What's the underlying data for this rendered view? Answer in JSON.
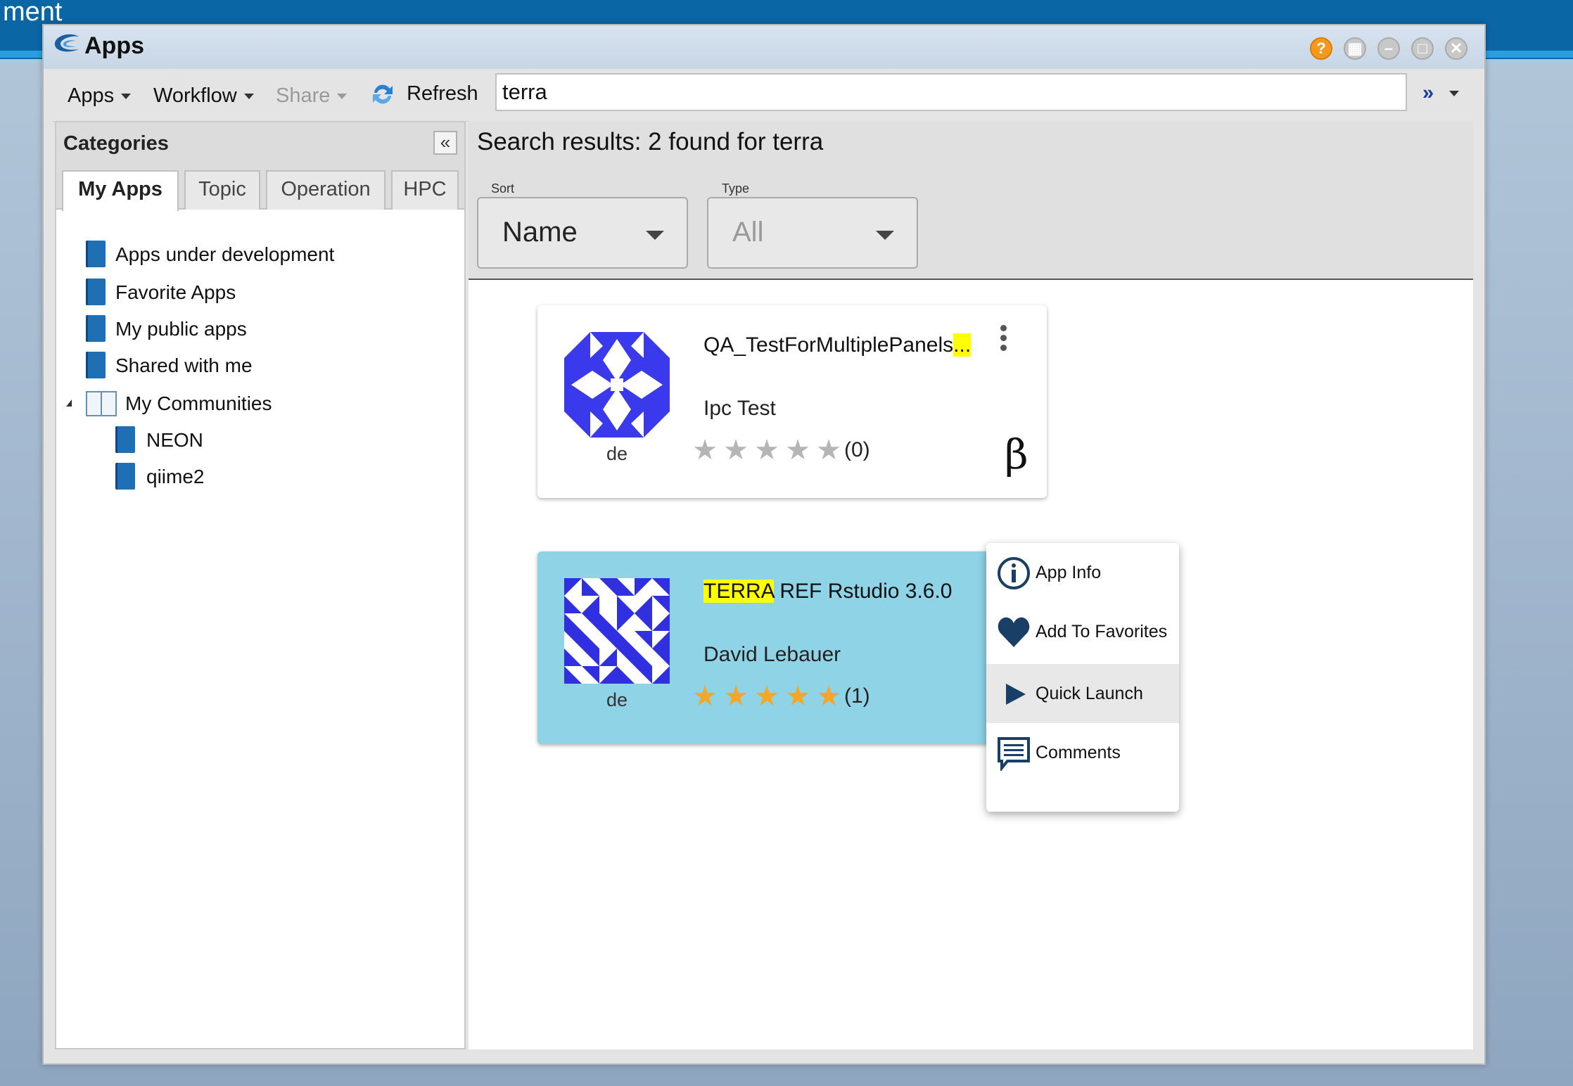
{
  "background": {
    "partial_title": "ment"
  },
  "window": {
    "title": "Apps",
    "buttons": [
      "help-icon",
      "layout-icon",
      "minimize-icon",
      "maximize-icon",
      "close-icon"
    ],
    "help_color": "#f39a1e"
  },
  "toolbar": {
    "apps": "Apps",
    "workflow": "Workflow",
    "share": "Share",
    "refresh": "Refresh",
    "search_value": "terra"
  },
  "categories": {
    "title": "Categories",
    "tabs": [
      "My Apps",
      "Topic",
      "Operation",
      "HPC"
    ],
    "active_tab": "My Apps",
    "items": [
      {
        "label": "Apps under development"
      },
      {
        "label": "Favorite Apps"
      },
      {
        "label": "My public apps"
      },
      {
        "label": "Shared with me"
      },
      {
        "label": "My Communities"
      },
      {
        "label": "NEON"
      },
      {
        "label": "qiime2"
      }
    ]
  },
  "results": {
    "title": "Search results: 2 found for terra",
    "sort_label": "Sort",
    "sort_value": "Name",
    "type_label": "Type",
    "type_value": "All",
    "cards": [
      {
        "name_prefix": "QA_TestForMultiplePanels",
        "name_highlight": "...",
        "name_suffix": "",
        "subtitle": "Ipc Test",
        "owner": "de",
        "rating": "(0)",
        "stars_filled": 0,
        "beta": "β"
      },
      {
        "name_prefix": "",
        "name_highlight": "TERRA",
        "name_suffix": " REF Rstudio 3.6.0",
        "subtitle": "David Lebauer",
        "owner": "de",
        "rating": "(1)",
        "stars_filled": 5
      }
    ]
  },
  "context_menu": {
    "items": [
      {
        "label": "App Info",
        "icon": "info-icon"
      },
      {
        "label": "Add To Favorites",
        "icon": "heart-icon"
      },
      {
        "label": "Quick Launch",
        "icon": "play-icon"
      },
      {
        "label": "Comments",
        "icon": "comment-icon"
      }
    ],
    "hovered": "Quick Launch"
  },
  "colors": {
    "accent_dark": "#1a3f66",
    "star_filled": "#f5a623",
    "star_empty": "#b5b5b5",
    "highlight": "#ffff00",
    "selected_card": "#8ed3e6"
  }
}
